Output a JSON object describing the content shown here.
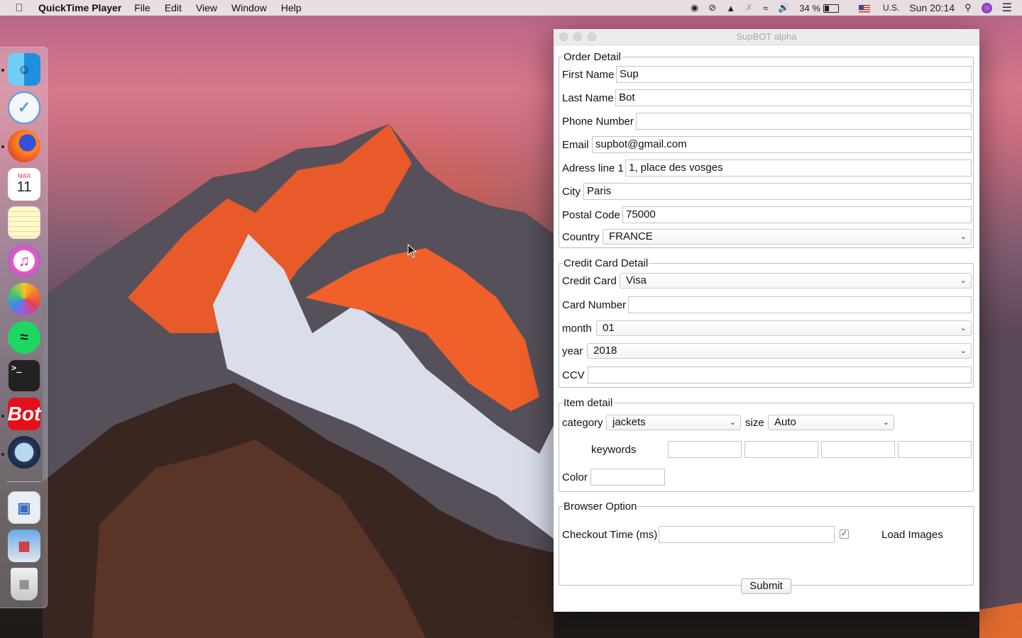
{
  "menubar": {
    "app_name": "QuickTime Player",
    "items": [
      "File",
      "Edit",
      "View",
      "Window",
      "Help"
    ],
    "battery": "34 %",
    "input_source": "U.S.",
    "clock": "Sun 20:14"
  },
  "dock": {
    "items": [
      {
        "name": "Finder",
        "icon": "finder-icon"
      },
      {
        "name": "Mail",
        "icon": "mail-icon"
      },
      {
        "name": "Firefox",
        "icon": "firefox-icon"
      },
      {
        "name": "Calendar",
        "icon": "calendar-icon",
        "month": "MAR",
        "day": "11"
      },
      {
        "name": "Notes",
        "icon": "notes-icon"
      },
      {
        "name": "iTunes",
        "icon": "itunes-icon"
      },
      {
        "name": "Photos",
        "icon": "photos-icon"
      },
      {
        "name": "Spotify",
        "icon": "spotify-icon"
      },
      {
        "name": "Terminal",
        "icon": "terminal-icon",
        "glyph": ">_"
      },
      {
        "name": "Bot",
        "icon": "bot-app-icon",
        "label": "Bot"
      },
      {
        "name": "QuickTime Player",
        "icon": "quicktime-icon"
      },
      {
        "name": "Preview",
        "icon": "preview-icon"
      },
      {
        "name": "App Store",
        "icon": "appstore-icon"
      },
      {
        "name": "Trash",
        "icon": "trash-icon"
      }
    ]
  },
  "window": {
    "title": "SupBOT alpha",
    "order": {
      "legend": "Order Detail",
      "first_name_label": "First Name",
      "first_name": "Sup",
      "last_name_label": "Last Name",
      "last_name": "Bot",
      "phone_label": "Phone Number",
      "phone": "",
      "email_label": "Email",
      "email": "supbot@gmail.com",
      "address_label": "Adress line 1",
      "address": "1, place des vosges",
      "city_label": "City",
      "city": "Paris",
      "postal_label": "Postal Code",
      "postal": "75000",
      "country_label": "Country",
      "country": "FRANCE"
    },
    "card": {
      "legend": "Credit Card Detail",
      "type_label": "Credit Card",
      "type": "Visa",
      "number_label": "Card Number",
      "number": "",
      "month_label": "month",
      "month": "01",
      "year_label": "year",
      "year": "2018",
      "ccv_label": "CCV",
      "ccv": ""
    },
    "item": {
      "legend": "Item detail",
      "category_label": "category",
      "category": "jackets",
      "size_label": "size",
      "size": "Auto",
      "keywords_label": "keywords",
      "keywords": [
        "",
        "",
        "",
        ""
      ],
      "color_label": "Color",
      "color": ""
    },
    "browser": {
      "legend": "Browser Option",
      "checkout_label": "Checkout Time (ms)",
      "checkout": "",
      "load_images_checked": true,
      "load_images_label": "Load Images"
    },
    "submit_label": "Submit"
  }
}
